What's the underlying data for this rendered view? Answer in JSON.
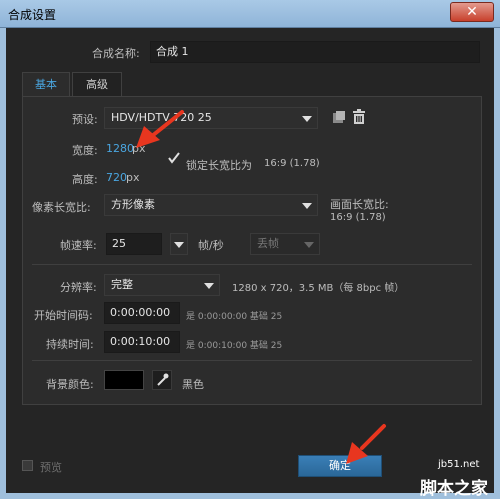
{
  "window": {
    "title": "合成设置",
    "close_label": "✕"
  },
  "comp_name": {
    "label": "合成名称:",
    "value": "合成 1"
  },
  "tabs": [
    {
      "label": "基本"
    },
    {
      "label": "高级"
    }
  ],
  "preset": {
    "label": "预设:",
    "value": "HDV/HDTV 720 25"
  },
  "width": {
    "label": "宽度:",
    "value": "1280",
    "unit": "px"
  },
  "lock_aspect": {
    "label": "锁定长宽比为",
    "ratio": "16:9 (1.78)",
    "checked": true
  },
  "height": {
    "label": "高度:",
    "value": "720",
    "unit": "px"
  },
  "pixel_aspect": {
    "label": "像素长宽比:",
    "value": "方形像素"
  },
  "frame_aspect": {
    "label": "画面长宽比:",
    "value": "16:9 (1.78)"
  },
  "frame_rate": {
    "label": "帧速率:",
    "value": "25",
    "unit": "帧/秒",
    "drop_frame": "丢帧"
  },
  "resolution": {
    "label": "分辨率:",
    "value": "完整",
    "info": "1280 x 720，3.5 MB（每 8bpc 帧）"
  },
  "start_timecode": {
    "label": "开始时间码:",
    "value": "0:00:00:00",
    "hint": "是 0:00:00:00  基础 25"
  },
  "duration": {
    "label": "持续时间:",
    "value": "0:00:10:00",
    "hint": "是 0:00:10:00  基础 25"
  },
  "background": {
    "label": "背景颜色:",
    "color": "#000000",
    "name": "黑色"
  },
  "footer": {
    "preview_label": "预览",
    "ok_label": "确定"
  },
  "watermark": {
    "site": "jb51.net",
    "brand": "脚本之家"
  },
  "colors": {
    "accent": "#4aa6e0",
    "arrow": "#e8361f"
  }
}
